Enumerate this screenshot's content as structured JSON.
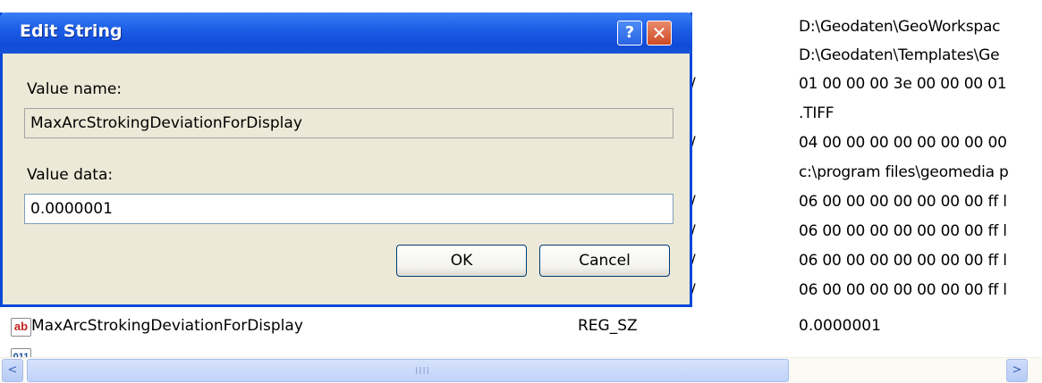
{
  "dialog": {
    "title": "Edit String",
    "help_glyph": "?",
    "close_glyph": "✕",
    "value_name_label": "Value name:",
    "value_name": "MaxArcStrokingDeviationForDisplay",
    "value_data_label": "Value data:",
    "value_data": "0.0000001",
    "ok_label": "OK",
    "cancel_label": "Cancel"
  },
  "registry": {
    "data_lines": [
      "D:\\Geodaten\\GeoWorkspac",
      "D:\\Geodaten\\Templates\\Ge",
      "01 00 00 00 3e 00 00 00 01",
      ".TIFF",
      "04 00 00 00 00 00 00 00 00",
      "c:\\program files\\geomedia p",
      "06 00 00 00 00 00 00 00 ff l",
      "06 00 00 00 00 00 00 00 ff l",
      "06 00 00 00 00 00 00 00 ff l",
      "06 00 00 00 00 00 00 00 ff l"
    ],
    "type_tick": "/",
    "selected_row": {
      "icon": "ab",
      "name": "MaxArcStrokingDeviationForDisplay",
      "type": "REG_SZ",
      "data": "0.0000001"
    },
    "partial_row": {
      "icon": "011"
    }
  },
  "scrollbar": {
    "left_arrow": "<",
    "right_arrow": ">",
    "grip": "IIII"
  },
  "colors": {
    "titlebar": "#0f4ad8",
    "dialog_face": "#ece9d8",
    "scrollbar_thumb": "#c1d3f9"
  }
}
